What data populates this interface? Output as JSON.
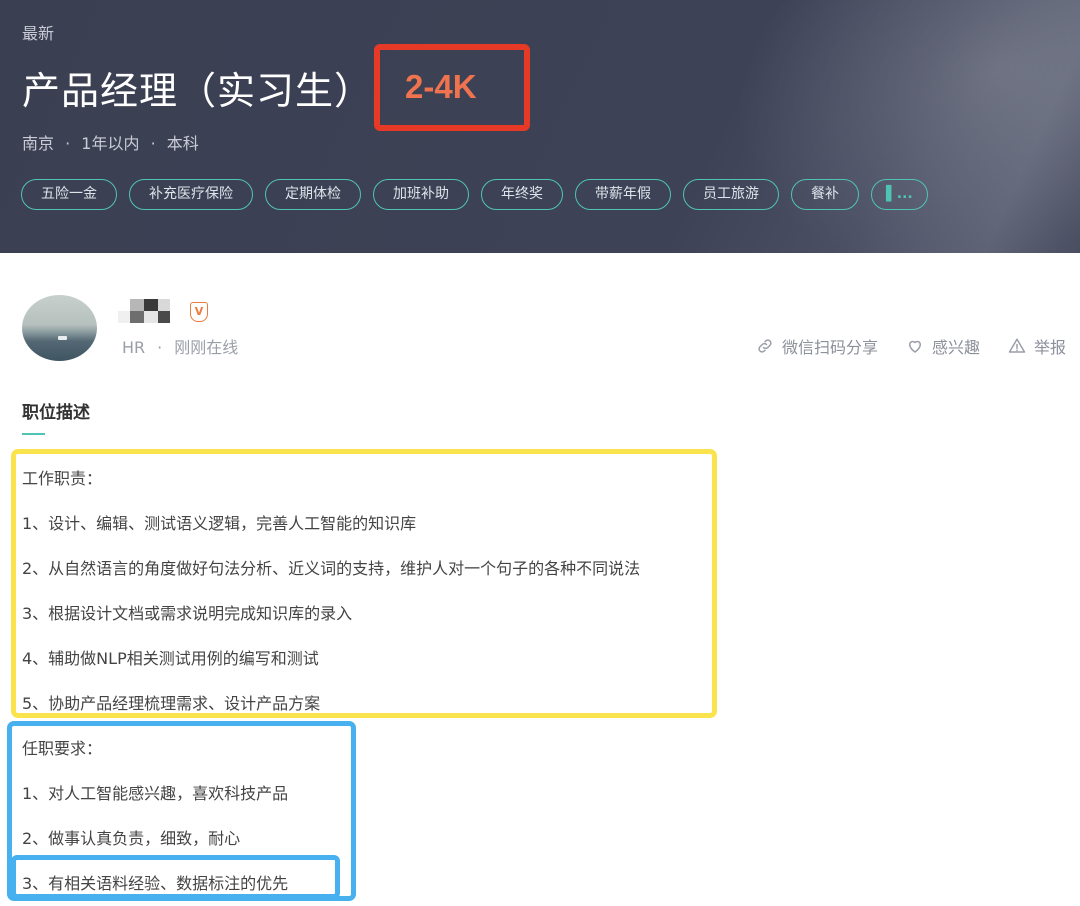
{
  "header": {
    "status_label": "最新",
    "job_title": "产品经理（实习生）",
    "salary": "2-4K",
    "meta": {
      "city": "南京",
      "experience": "1年以内",
      "education": "本科"
    },
    "meta_separator": "·",
    "tags": [
      "五险一金",
      "补充医疗保险",
      "定期体检",
      "加班补助",
      "年终奖",
      "带薪年假",
      "员工旅游",
      "餐补"
    ],
    "more_tag": "▌..."
  },
  "recruiter": {
    "role": "HR",
    "separator": "·",
    "status": "刚刚在线",
    "verified_icon": "v-badge-icon"
  },
  "actions": {
    "share": {
      "label": "微信扫码分享",
      "icon": "link-icon"
    },
    "interest": {
      "label": "感兴趣",
      "icon": "heart-icon"
    },
    "report": {
      "label": "举报",
      "icon": "warning-icon"
    }
  },
  "description": {
    "section_title": "职位描述",
    "duties_heading": "工作职责：",
    "duties": [
      "1、设计、编辑、测试语义逻辑，完善人工智能的知识库",
      "2、从自然语言的角度做好句法分析、近义词的支持，维护人对一个句子的各种不同说法",
      "3、根据设计文档或需求说明完成知识库的录入",
      "4、辅助做NLP相关测试用例的编写和测试",
      "5、协助产品经理梳理需求、设计产品方案"
    ],
    "requirements_heading": "任职要求：",
    "requirements": [
      "1、对人工智能感兴趣，喜欢科技产品",
      "2、做事认真负责，细致，耐心",
      "3、有相关语料经验、数据标注的优先"
    ]
  },
  "colors": {
    "header_bg": "#3e4256",
    "tag_border": "#4fc4b5",
    "salary": "#f07350",
    "annotation_red": "#e63a26",
    "annotation_yellow": "#fbe34e",
    "annotation_blue": "#46b1ee"
  }
}
